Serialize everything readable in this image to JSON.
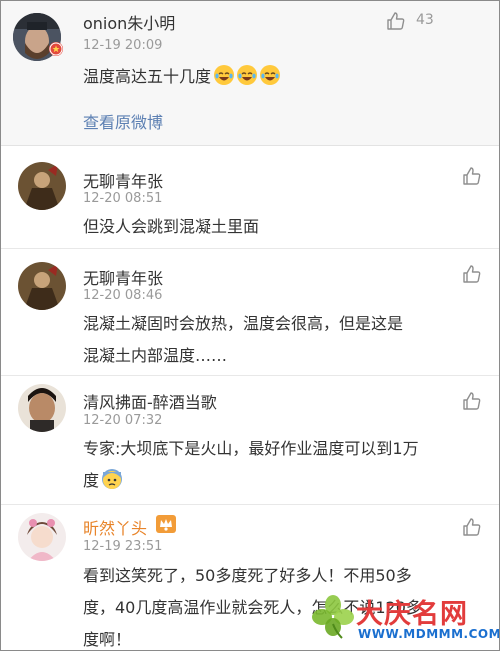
{
  "main_comment": {
    "username": "onion朱小明",
    "time": "12-19 20:09",
    "text": "温度高达五十几度",
    "emojis": [
      "laughing-tears-emoji",
      "laughing-tears-emoji",
      "laughing-tears-emoji"
    ],
    "likes": "43",
    "view_original": "查看原微博"
  },
  "replies": [
    {
      "username": "无聊青年张",
      "time": "12-20 08:51",
      "lines": [
        "但没人会跳到混凝土里面"
      ]
    },
    {
      "username": "无聊青年张",
      "time": "12-20 08:46",
      "lines": [
        "混凝土凝固时会放热，温度会很高，但是这是",
        "混凝土内部温度……"
      ]
    },
    {
      "username": "清风拂面-醉酒当歌",
      "time": "12-20 07:32",
      "lines": [
        "专家:大坝底下是火山，最好作业温度可以到1万",
        "度"
      ],
      "emoji": "weary-emoji"
    },
    {
      "username": "昕然丫头",
      "time": "12-19 23:51",
      "lines": [
        "看到这笑死了，50多度死了好多人！不用50多",
        "度，40几度高温作业就会死人，怎么不说120多",
        "度啊！"
      ]
    }
  ],
  "watermark": {
    "text": "大庆名网",
    "url": "WWW.MDMMM.COM"
  },
  "colors": {
    "link": "#5d80b3",
    "vip_name": "#e8842a",
    "main_bg": "#f7f7f7"
  }
}
